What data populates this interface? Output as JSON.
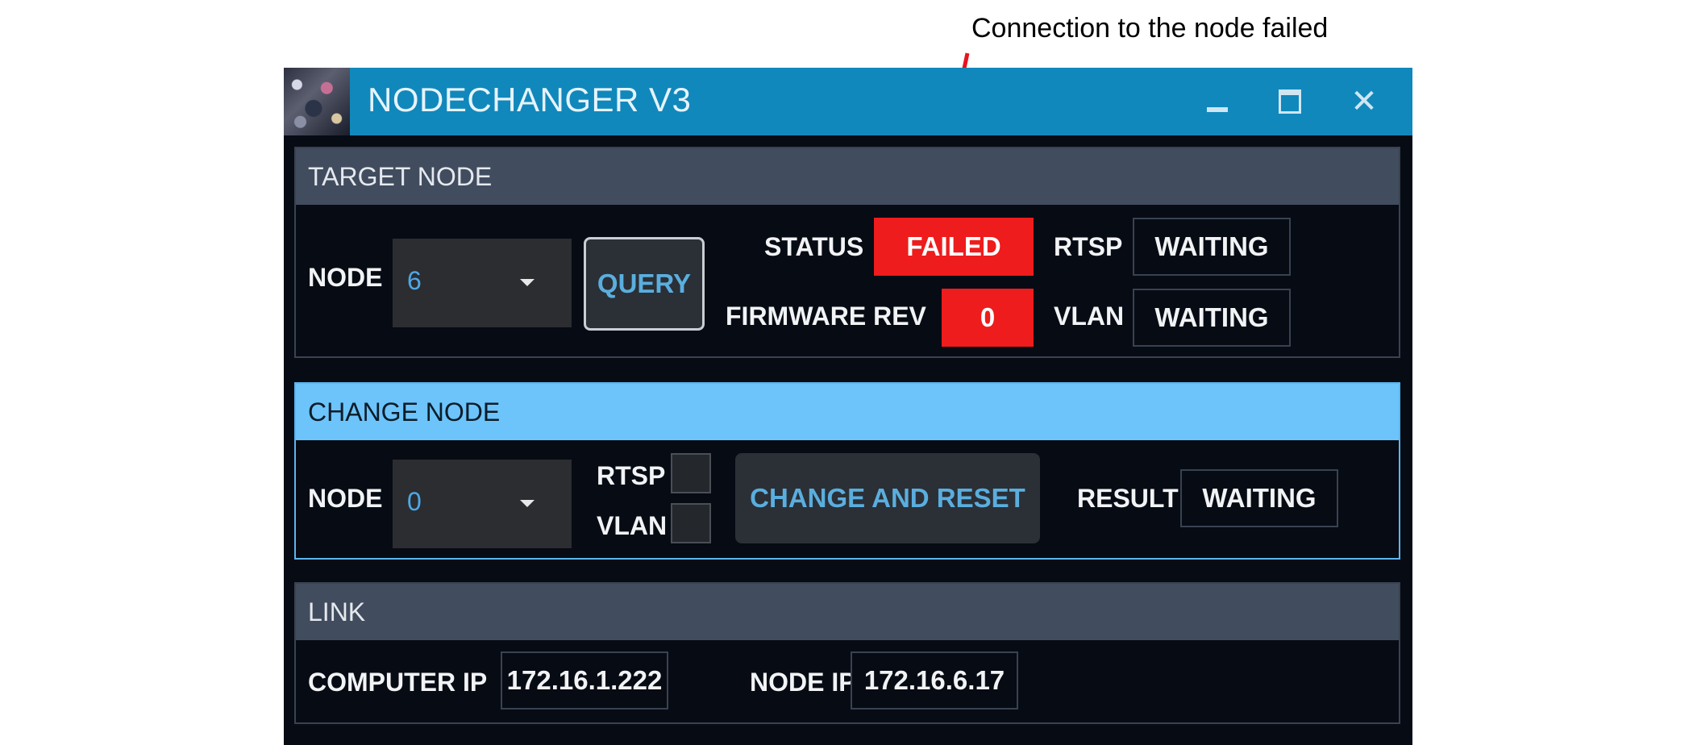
{
  "annotation": {
    "text": "Connection to the node failed"
  },
  "window": {
    "title": "NODECHANGER V3",
    "controls": {
      "minimize": "minimize-icon",
      "maximize": "maximize-icon",
      "close": "close-icon",
      "close_glyph": "✕"
    }
  },
  "target_node": {
    "header": "TARGET NODE",
    "node_label": "NODE",
    "node_value": "6",
    "query_label": "QUERY",
    "status_label": "STATUS",
    "status_value": "FAILED",
    "firmware_label": "FIRMWARE REV",
    "firmware_value": "0",
    "rtsp_label": "RTSP",
    "rtsp_value": "WAITING",
    "vlan_label": "VLAN",
    "vlan_value": "WAITING"
  },
  "change_node": {
    "header": "CHANGE NODE",
    "node_label": "NODE",
    "node_value": "0",
    "rtsp_label": "RTSP",
    "rtsp_checked": false,
    "vlan_label": "VLAN",
    "vlan_checked": false,
    "change_button_label": "CHANGE AND RESET",
    "result_label": "RESULT",
    "result_value": "WAITING"
  },
  "link": {
    "header": "LINK",
    "computer_ip_label": "COMPUTER IP",
    "computer_ip_value": "172.16.1.222",
    "node_ip_label": "NODE IP",
    "node_ip_value": "172.16.6.17"
  },
  "colors": {
    "titlebar": "#1188bb",
    "window_bg": "#070b14",
    "panel_header": "#414c5e",
    "active_header": "#6cc4fb",
    "status_failed": "#ee1c1c",
    "accent_text": "#4ea8e6",
    "arrow": "#e8141c"
  }
}
